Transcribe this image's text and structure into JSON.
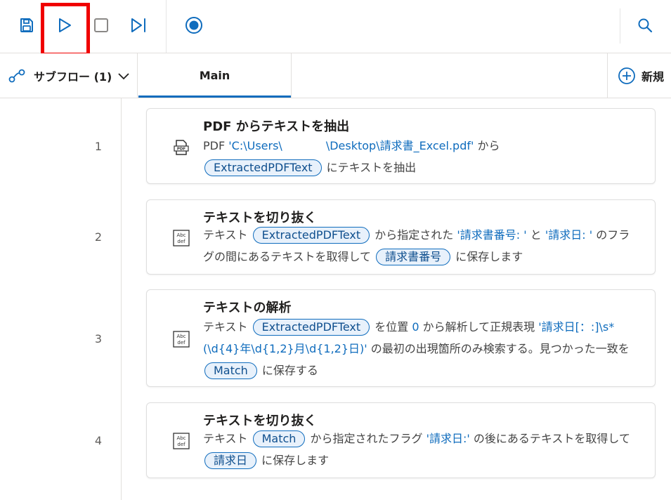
{
  "toolbar": {
    "buttons": [
      {
        "icon": "save-icon"
      },
      {
        "icon": "run-icon"
      },
      {
        "icon": "stop-icon"
      },
      {
        "icon": "next-step-icon"
      },
      {
        "icon": "record-icon"
      },
      {
        "icon": "search-icon"
      }
    ],
    "accent_color": "#0f6cbd",
    "highlight_color": "#f00000"
  },
  "tabs": {
    "subflow_label": "サブフロー (1)",
    "main_label": "Main",
    "new_label": "新規"
  },
  "steps": [
    {
      "num": "1",
      "title": "PDF からテキストを抽出",
      "icon": "pdf-icon",
      "desc": {
        "t1": "PDF ",
        "path": "'C:\\Users\\",
        "path2": "\\Desktop\\請求書_Excel.pdf'",
        "t2": " から",
        "var1": "ExtractedPDFText",
        "t3": " にテキストを抽出"
      }
    },
    {
      "num": "2",
      "title": "テキストを切り抜く",
      "icon": "text-abc-icon",
      "desc": {
        "t1": "テキスト ",
        "var1": "ExtractedPDFText",
        "t2": " から指定された ",
        "lit1": "'請求書番号: '",
        "t3": " と ",
        "lit2": "'請求日: '",
        "t4": " のフラグの間にあるテキストを取得して ",
        "var2": "請求書番号",
        "t5": " に保存します"
      }
    },
    {
      "num": "3",
      "title": "テキストの解析",
      "icon": "text-abc-icon",
      "desc": {
        "t1": "テキスト ",
        "var1": "ExtractedPDFText",
        "t2": " を位置 ",
        "lit1": "0",
        "t3": " から解析して正規表現 ",
        "lit2": "'請求日[：:]\\s*(\\d{4}年\\d{1,2}月\\d{1,2}日)'",
        "t4": " の最初の出現箇所のみ検索する。見つかった一致を ",
        "var2": "Match",
        "t5": " に保存する"
      }
    },
    {
      "num": "4",
      "title": "テキストを切り抜く",
      "icon": "text-abc-icon",
      "desc": {
        "t1": "テキスト ",
        "var1": "Match",
        "t2": " から指定されたフラグ ",
        "lit1": "'請求日:'",
        "t3": " の後にあるテキストを取得して ",
        "var2": "請求日",
        "t4": " に保存します"
      }
    }
  ]
}
